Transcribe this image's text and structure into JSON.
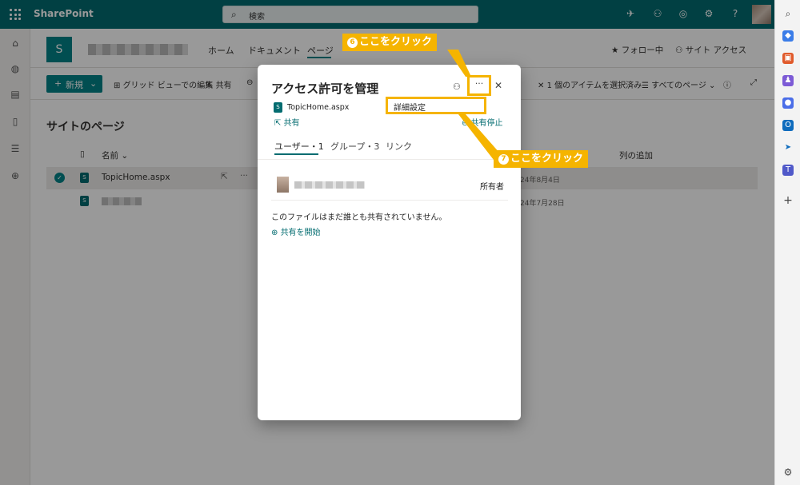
{
  "suite": {
    "app_name": "SharePoint",
    "search_placeholder": "検索"
  },
  "site": {
    "logo_letter": "S",
    "nav": [
      "ホーム",
      "ドキュメント",
      "ページ"
    ],
    "follow_label": "フォロー中",
    "site_access_label": "サイト アクセス"
  },
  "commandbar": {
    "new_label": "新規",
    "grid_edit_label": "グリッド ビューでの編集",
    "share_label": "共有",
    "selected_label": "1 個のアイテムを選択済み",
    "all_pages_label": "すべてのページ"
  },
  "list": {
    "title": "サイトのページ",
    "col_name": "名前",
    "col_added": "列の追加",
    "rows": [
      {
        "name": "TopicHome.aspx",
        "date": "24年8月4日"
      },
      {
        "name": "",
        "date": "24年7月28日"
      }
    ]
  },
  "dialog": {
    "title": "アクセス許可を管理",
    "file_name": "TopicHome.aspx",
    "share_label": "共有",
    "stop_sharing_label": "共有停止",
    "tabs": [
      "ユーザー・1",
      "グループ・3",
      "リンク"
    ],
    "owner_role": "所有者",
    "empty_text": "このファイルはまだ誰とも共有されていません。",
    "start_sharing_label": "共有を開始",
    "more_label": "···"
  },
  "menu": {
    "advanced_settings_label": "詳細設定"
  },
  "callouts": {
    "step6": {
      "num": "6",
      "text": "ここをクリック"
    },
    "step7": {
      "num": "7",
      "text": "ここをクリック"
    }
  },
  "colors": {
    "suite_bar": "#036c70",
    "accent": "#038387",
    "callout": "#f5b400"
  }
}
